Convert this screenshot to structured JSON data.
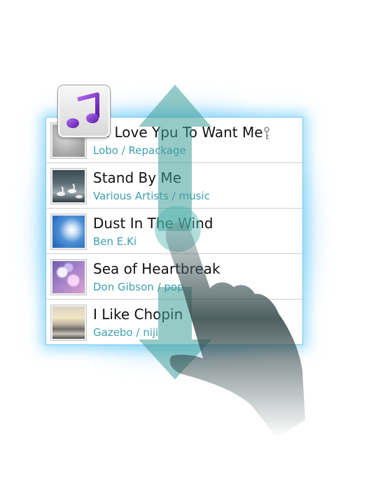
{
  "tracks": [
    {
      "title": "I'd Love Ypu To Want Me",
      "subtitle": "Lobo / Repackage",
      "thumb": "grey-blur-thumbnail",
      "protected": true
    },
    {
      "title": "Stand By Me",
      "subtitle": "Various Artists / music",
      "thumb": "swans-lake-thumbnail",
      "protected": false
    },
    {
      "title": "Dust In The Wind",
      "subtitle": "Ben E.Ki",
      "thumb": "blue-sky-thumbnail",
      "protected": false
    },
    {
      "title": "Sea of Heartbreak",
      "subtitle": "Don Gibson / pop",
      "thumb": "bokeh-lights-thumbnail",
      "protected": false
    },
    {
      "title": "I Like Chopin",
      "subtitle": "Gazebo / niji",
      "thumb": "sunset-clouds-thumbnail",
      "protected": false
    }
  ],
  "icons": {
    "app": "music-note-icon",
    "protected": "key-icon",
    "gesture": "scroll-up-down-arrows",
    "hand": "pointing-hand"
  },
  "colors": {
    "accent": "#3e9fb1",
    "glow": "#46bef5",
    "arrow": "#4ba7a3",
    "music_icon": "#7b2cc2"
  }
}
